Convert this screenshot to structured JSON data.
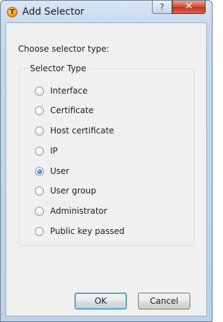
{
  "window": {
    "title": "Add Selector",
    "app_icon_glyph": "T",
    "help_glyph": "?",
    "close_glyph": "✕"
  },
  "dialog": {
    "prompt": "Choose selector type:",
    "group_title": "Selector Type",
    "options": [
      {
        "label": "Interface",
        "checked": false
      },
      {
        "label": "Certificate",
        "checked": false
      },
      {
        "label": "Host certificate",
        "checked": false
      },
      {
        "label": "IP",
        "checked": false
      },
      {
        "label": "User",
        "checked": true
      },
      {
        "label": "User group",
        "checked": false
      },
      {
        "label": "Administrator",
        "checked": false
      },
      {
        "label": "Public key passed",
        "checked": false
      }
    ],
    "ok_label": "OK",
    "cancel_label": "Cancel"
  },
  "colors": {
    "title_bar": "#c6d9ee",
    "client_bg": "#f0f0f0",
    "close_button": "#c2321c",
    "radio_selected": "#2a7fd6"
  }
}
